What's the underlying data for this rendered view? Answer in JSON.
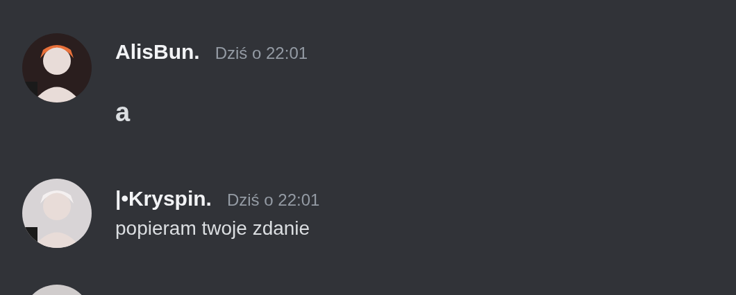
{
  "messages": [
    {
      "kind": "jumbo",
      "author": "AlisBun.",
      "timestamp": "Dziś o 22:01",
      "text": "a"
    },
    {
      "kind": "text",
      "author": "|•Kryspin.",
      "timestamp": "Dziś o 22:01",
      "text": "popieram twoje zdanie"
    },
    {
      "kind": "cut"
    }
  ]
}
